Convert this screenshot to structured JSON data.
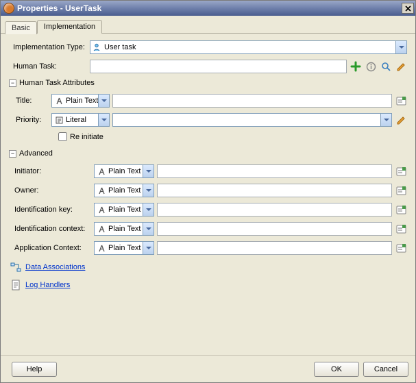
{
  "title": "Properties - UserTask",
  "tabs": {
    "basic": "Basic",
    "implementation": "Implementation",
    "active": "implementation"
  },
  "form": {
    "impl_type_label": "Implementation Type:",
    "impl_type_value": "User task",
    "human_task_label": "Human Task:",
    "human_task_value": ""
  },
  "section_attrs": {
    "title": "Human Task Attributes",
    "title_label": "Title:",
    "title_type": "Plain Text",
    "title_value": "",
    "priority_label": "Priority:",
    "priority_type": "Literal",
    "priority_value": "",
    "reinitiate_label": "Re initiate",
    "reinitiate_checked": false
  },
  "section_adv": {
    "title": "Advanced",
    "rows": [
      {
        "label": "Initiator:",
        "type": "Plain Text",
        "value": ""
      },
      {
        "label": "Owner:",
        "type": "Plain Text",
        "value": ""
      },
      {
        "label": "Identification key:",
        "type": "Plain Text",
        "value": ""
      },
      {
        "label": "Identification context:",
        "type": "Plain Text",
        "value": ""
      },
      {
        "label": "Application Context:",
        "type": "Plain Text",
        "value": ""
      }
    ]
  },
  "links": {
    "data_assoc": "Data Associations",
    "log_handlers": "Log Handlers"
  },
  "buttons": {
    "help": "Help",
    "ok": "OK",
    "cancel": "Cancel"
  }
}
